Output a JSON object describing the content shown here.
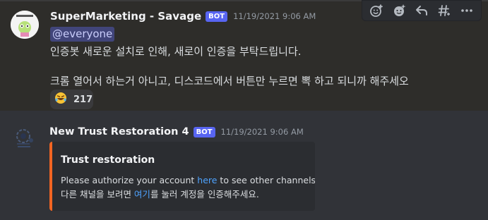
{
  "message1": {
    "author": "SuperMarketing - Savage",
    "bot_badge": "BOT",
    "timestamp": "11/19/2021 9:06 AM",
    "mention": "@everyone",
    "lines": [
      "인증봇 새로운 설치로 인해, 새로이 인증을 부탁드립니다.",
      "크롬 열어서 하는거 아니고, 디스코드에서 버튼만 누르면 뽁 하고 되니까 해주세오"
    ],
    "reaction": {
      "emoji": "rolling-on-floor-laughing",
      "count": "217"
    }
  },
  "toolbar": {
    "icons": [
      "add-reaction-icon",
      "super-reaction-icon",
      "reply-icon",
      "create-thread-icon",
      "more-icon"
    ]
  },
  "message2": {
    "author": "New Trust Restoration 4",
    "bot_badge": "BOT",
    "timestamp": "11/19/2021 9:06 AM",
    "embed": {
      "accent_color": "#f26522",
      "title": "Trust restoration",
      "desc_line1_pre": "Please authorize your account ",
      "desc_line1_link": "here",
      "desc_line1_post": " to see other channels.",
      "desc_line2_pre": "다른 채널을 보려면 ",
      "desc_line2_link": "여기",
      "desc_line2_post": "를 눌러 계정을 인증해주세요."
    }
  },
  "colors": {
    "background": "#313338",
    "highlight_background": "#2e2d2a",
    "bot_badge": "#5865f2",
    "link": "#4ea3ff",
    "mention_bg": "#41457a"
  }
}
